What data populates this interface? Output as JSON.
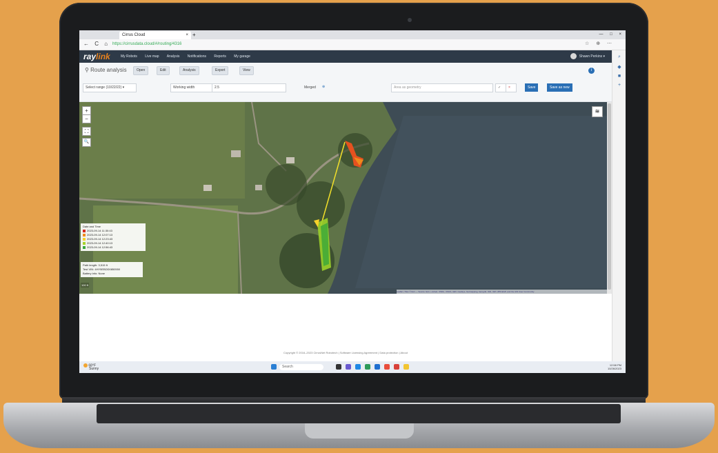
{
  "browser": {
    "tab_title": "Cirrus Cloud",
    "tab_close": "×",
    "new_tab": "+",
    "window_controls": "— □ ×",
    "nav": "← C ⌂",
    "url": "https://cirrusdata.cloud/#/routing/4316",
    "icons": "☆ ⊕ ⋯"
  },
  "app": {
    "logo_main": "ray",
    "logo_accent": "link",
    "menu": [
      "My Robots",
      "Live map",
      "Analysis",
      "Notifications",
      "Reports",
      "My garage"
    ],
    "user_name": "Shawn Perkins ▾"
  },
  "toolbar": {
    "title": "Route analysis",
    "buttons": [
      "Open",
      "Edit",
      "Analysis",
      "Export",
      "View"
    ]
  },
  "options": {
    "date_select": "Select range (10/22/22) ▾",
    "working_width_label": "Working width",
    "working_width_value": "2.5",
    "merged_label": "Merged",
    "search_placeholder": "Area as geometry",
    "save": "Save",
    "save_as_new": "Save as new"
  },
  "map": {
    "zoom_in": "+",
    "zoom_out": "−",
    "fullscreen": "⛶",
    "search": "🔍",
    "layers": "≋",
    "legend_title": "Date and Time",
    "legend_items": [
      {
        "label": "2023-09-14 11:30:43",
        "color": "#d62a1d"
      },
      {
        "label": "2023-09-14 12:07:13",
        "color": "#f08a1c"
      },
      {
        "label": "2023-09-14 12:23:43",
        "color": "#f6d22a"
      },
      {
        "label": "2023-09-14 12:40:13",
        "color": "#a6d32a"
      },
      {
        "label": "2023-09-14 12:56:43",
        "color": "#3aa83a"
      }
    ],
    "path_length_label": "Path length",
    "path_length_value": "3,515 ft",
    "test_vin_label": "Test VIN",
    "test_vin_value": "4HY5EBDD0850550",
    "battery_label": "Battery info",
    "battery_value": "None",
    "scale": "100 ft",
    "attribution": "Leaflet | Tiles © Esri — Source: Esri, i-cubed, USDA, USGS, AEX, GeoEye, Getmapping, Aerogrid, IGN, IGP, UPR-EGP, and the GIS User Community"
  },
  "footer": "Copyright © 2016–2023 CirrusNet Robotech | Software Licensing Agreement | Data protection | About",
  "taskbar": {
    "weather_temp": "68°F",
    "weather_desc": "Sunny",
    "search": "Search",
    "time": "12:58 PM",
    "date": "10/26/2023"
  }
}
